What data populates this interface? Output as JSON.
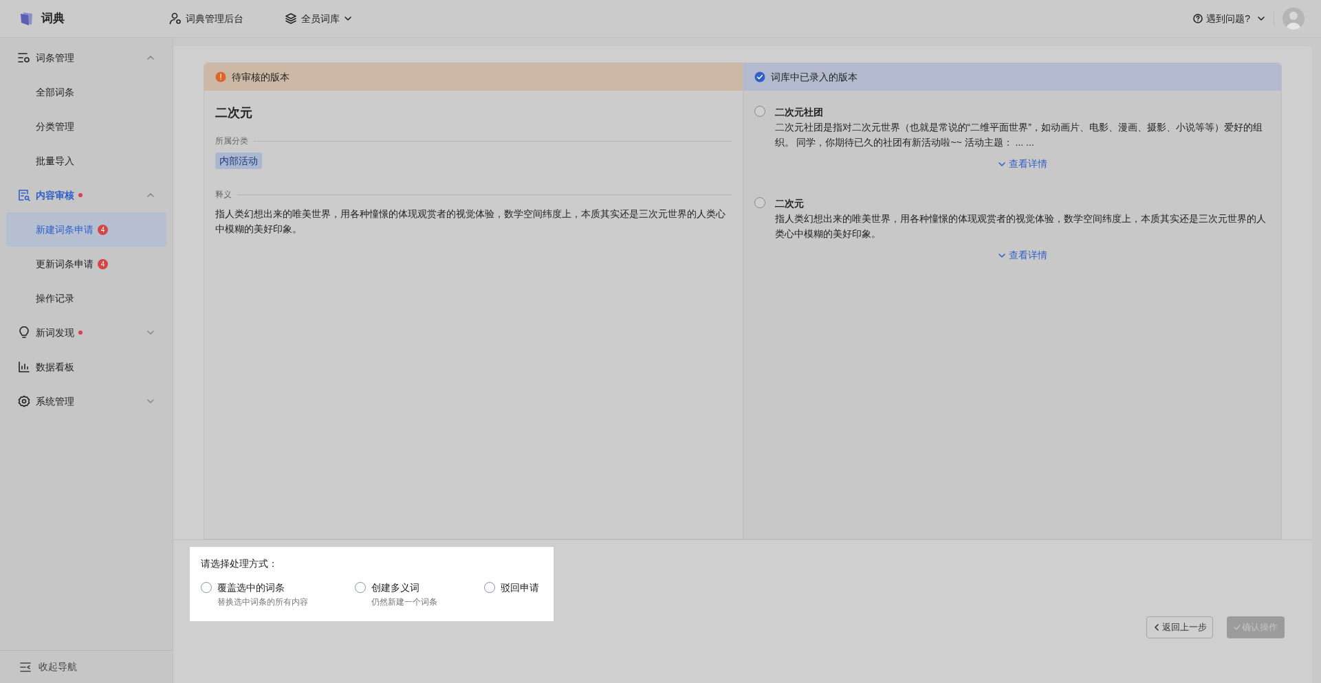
{
  "header": {
    "logo_text": "词典",
    "nav": [
      {
        "kind": "admin",
        "label": "词典管理后台",
        "dropdown": false
      },
      {
        "kind": "layers",
        "label": "全员词库",
        "dropdown": true
      }
    ],
    "help": "遇到问题?"
  },
  "sidebar": {
    "groups": [
      {
        "kind": "list-gear",
        "label": "词条管理",
        "expanded": true,
        "dot": false,
        "children": [
          {
            "label": "全部词条",
            "selected": false
          },
          {
            "label": "分类管理",
            "selected": false
          },
          {
            "label": "批量导入",
            "selected": false
          }
        ]
      },
      {
        "kind": "doc-search",
        "label": "内容审核",
        "expanded": true,
        "dot": true,
        "active": true,
        "children": [
          {
            "label": "新建词条申请",
            "selected": true,
            "badge": "4"
          },
          {
            "label": "更新词条申请",
            "selected": false,
            "badge": "4"
          },
          {
            "label": "操作记录",
            "selected": false
          }
        ]
      },
      {
        "kind": "bulb",
        "label": "新词发现",
        "expanded": false,
        "dot": true,
        "active": false
      },
      {
        "kind": "chart",
        "label": "数据看板",
        "dot": false,
        "active": false
      },
      {
        "kind": "gear",
        "label": "系统管理",
        "expanded": false,
        "dot": false,
        "active": false
      }
    ],
    "footer": "收起导航"
  },
  "pending": {
    "title": "待审核的版本",
    "term": "二次元",
    "category_label": "所属分类",
    "category_tag": "内部活动",
    "definition_label": "释义",
    "definition": "指人类幻想出来的唯美世界，用各种憧憬的体现观赏者的视觉体验，数学空间纬度上，本质其实还是三次元世界的人类心中模糊的美好印象。"
  },
  "existing": {
    "title": "词库中已录入的版本",
    "entries": [
      {
        "selected": false,
        "title": "二次元社团",
        "text": "二次元社团是指对二次元世界（也就是常说的“二维平面世界”，如动画片、电影、漫画、摄影、小说等等）爱好的组织。 同学，你期待已久的社团有新活动啦~~ 活动主题： ... ...",
        "link": "查看详情"
      },
      {
        "selected": false,
        "title": "二次元",
        "text": "指人类幻想出来的唯美世界，用各种憧憬的体现观赏者的视觉体验，数学空间纬度上，本质其实还是三次元世界的人类心中模糊的美好印象。",
        "link": "查看详情"
      }
    ]
  },
  "action": {
    "prompt": "请选择处理方式：",
    "options": [
      {
        "label": "覆盖选中的词条",
        "hint": "替换选中词条的所有内容",
        "selected": false
      },
      {
        "label": "创建多义词",
        "hint": "仍然新建一个词条",
        "selected": false
      },
      {
        "label": "驳回申请",
        "selected": false
      }
    ]
  },
  "buttons": {
    "back": "返回上一步",
    "confirm": {
      "label": "确认操作",
      "disabled": true
    }
  }
}
